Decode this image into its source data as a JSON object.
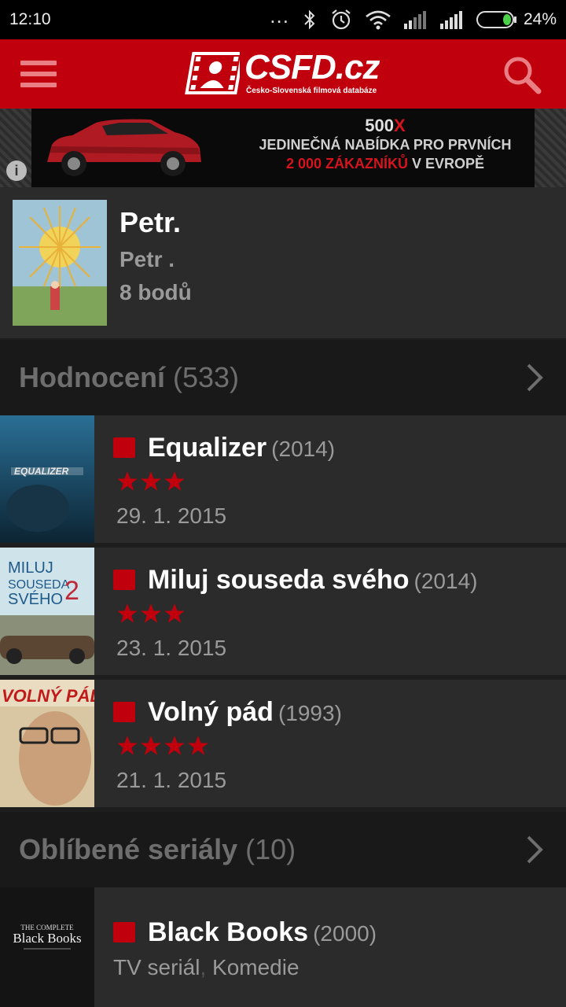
{
  "status_bar": {
    "time": "12:10",
    "dots": "...",
    "battery_percent": "24%",
    "battery_level": 0.24
  },
  "header": {
    "logo_text": "CSFD.cz",
    "logo_subtitle": "Česko-Slovenská filmová databáze"
  },
  "ad": {
    "line1_a": "500",
    "line1_b": "X",
    "line2": "JEDINEČNÁ NABÍDKA PRO PRVNÍCH",
    "line3_red": "2 000 ZÁKAZNÍKŮ",
    "line3_rest": " V EVROPĚ",
    "info_icon": "i"
  },
  "profile": {
    "name": "Petr.",
    "subname": "Petr .",
    "points": "8 bodů"
  },
  "ratings_section": {
    "title": "Hodnocení",
    "count": "(533)"
  },
  "ratings": [
    {
      "title": "Equalizer",
      "year": "(2014)",
      "stars": 3,
      "date": "29. 1. 2015"
    },
    {
      "title": "Miluj souseda svého",
      "year": "(2014)",
      "stars": 3,
      "date": "23. 1. 2015"
    },
    {
      "title": "Volný pád",
      "year": "(1993)",
      "stars": 4,
      "date": "21. 1. 2015"
    }
  ],
  "series_section": {
    "title": "Oblíbené seriály",
    "count": "(10)"
  },
  "series": [
    {
      "title": "Black Books",
      "year": "(2000)",
      "type": "TV seriál",
      "sep": ",",
      "genre": " Komedie"
    }
  ],
  "colors": {
    "brand_red": "#c0000c",
    "star_red": "#c0000c"
  }
}
